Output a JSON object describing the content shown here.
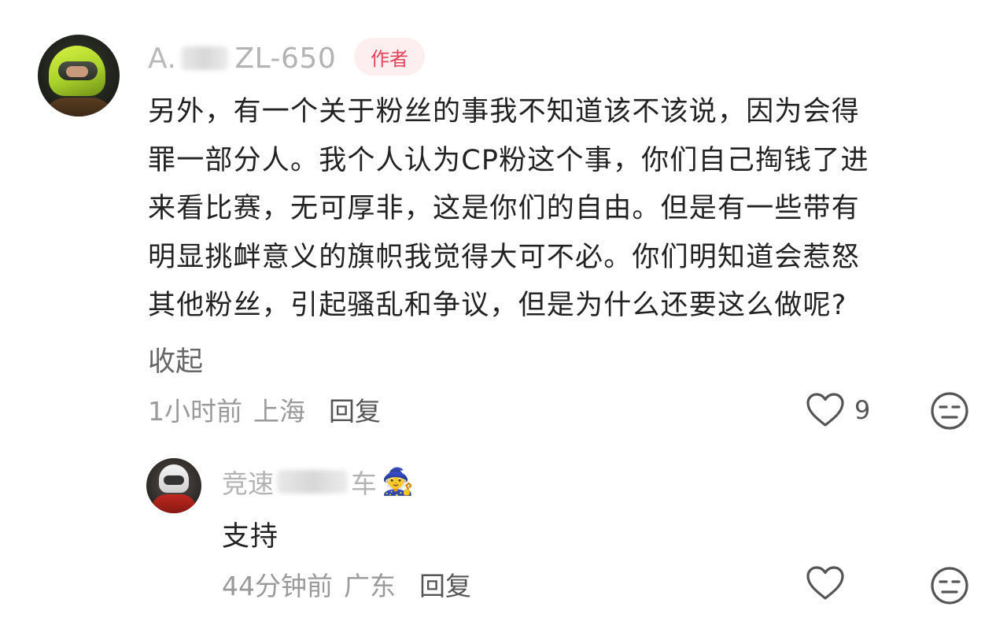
{
  "comment": {
    "username_prefix": "A.",
    "username_suffix": "ZL-650",
    "author_badge": "作者",
    "text_lines": [
      "另外，有一个关于粉丝的事我不知道该不该说，因为会得",
      "罪一部分人。我个人认为CP粉这个事，你们自己掏钱了进",
      "来看比赛，无可厚非，这是你们的自由。但是有一些带有",
      "明显挑衅意义的旗帜我觉得大可不必。你们明知道会惹怒",
      "其他粉丝，引起骚乱和争议，但是为什么还要这么做呢?"
    ],
    "collapse_label": "收起",
    "time": "1小时前",
    "location": "上海",
    "reply_label": "回复",
    "like_count": "9",
    "like_icon": "heart-outline-icon",
    "dislike_icon": "meh-face-icon"
  },
  "reply": {
    "username_prefix": "竞速",
    "username_suffix": "车",
    "username_emoji": "🧙",
    "text": "支持",
    "time": "44分钟前",
    "location": "广东",
    "reply_label": "回复",
    "like_icon": "heart-outline-icon",
    "dislike_icon": "meh-face-icon"
  },
  "colors": {
    "badge_bg": "#fdeef0",
    "badge_text": "#e6425a",
    "muted_text": "#9a9a9a",
    "body_text": "#222222"
  }
}
